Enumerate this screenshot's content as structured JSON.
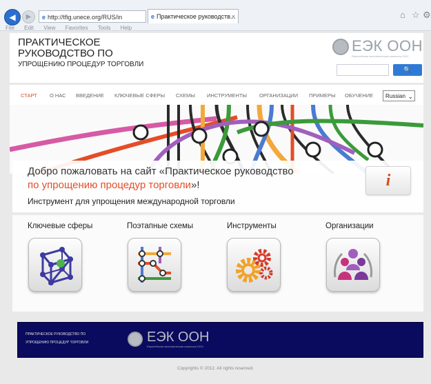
{
  "browser": {
    "address": "http://tfig.unece.org/RUS/in",
    "address_domain_bold": "unece.org",
    "tab_title": "Практическое руководств...",
    "tab_close": "×",
    "menu": [
      "File",
      "Edit",
      "View",
      "Favorites",
      "Tools",
      "Help"
    ],
    "icons": {
      "back": "back-arrow-icon",
      "forward": "forward-arrow-icon",
      "home": "home-icon",
      "favorites": "star-icon",
      "tools": "gear-icon"
    }
  },
  "header": {
    "title_line1": "ПРАКТИЧЕСКОЕ",
    "title_line2": "РУКОВОДСТВО ПО",
    "title_line3": "УПРОЩЕНИЮ ПРОЦЕДУР ТОРГОВЛИ",
    "logo_text": "ЕЭК ООН",
    "logo_subtext": "Европейская экономическая комиссия ООН",
    "search_placeholder": "",
    "search_button": "🔍"
  },
  "nav": {
    "items": [
      "СТАРТ",
      "О НАС",
      "ВВЕДЕНИЕ",
      "КЛЮЧЕВЫЕ СФЕРЫ",
      "СХЕМЫ",
      "ИНСТРУМЕНТЫ",
      "ОРГАНИЗАЦИИ",
      "ПРИМЕРЫ",
      "ОБУЧЕНИЕ"
    ],
    "active": "СТАРТ",
    "language": "Russian"
  },
  "hero": {
    "welcome_line1": "Добро пожаловать на сайт «Практическое руководство",
    "welcome_line2": "по упрощению процедур торговли",
    "welcome_line2_end": "»!",
    "subtitle": "Инструмент для упрощения международной торговли",
    "info_button": "i"
  },
  "features": [
    {
      "label": "Ключевые сферы",
      "icon": "cube-network-icon"
    },
    {
      "label": "Поэтапные схемы",
      "icon": "flow-map-icon"
    },
    {
      "label": "Инструменты",
      "icon": "gears-icon"
    },
    {
      "label": "Организации",
      "icon": "people-group-icon"
    }
  ],
  "footer": {
    "text_line1": "ПРАКТИЧЕСКОЕ РУКОВОДСТВО ПО",
    "text_line2": "УПРОЩЕНИЮ ПРОЦЕДУР ТОРГОВЛИ",
    "logo_text": "ЕЭК ООН",
    "logo_subtext": "Европейская экономическая комиссия ООН",
    "copyright": "Copyrights © 2012. All rights reserved."
  },
  "colors": {
    "accent": "#e44d26",
    "button_blue": "#2f7ad6",
    "footer_bg": "#0a0a5e"
  }
}
